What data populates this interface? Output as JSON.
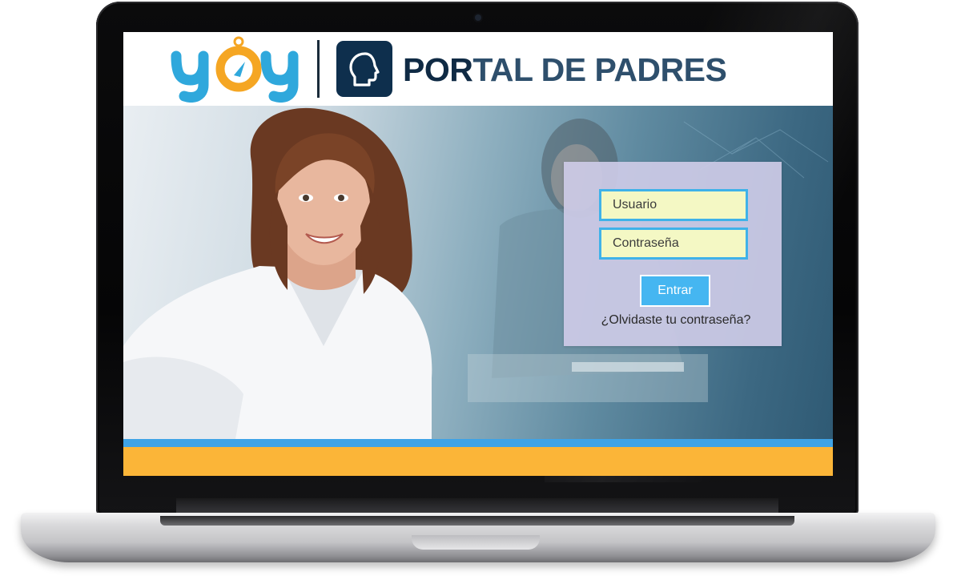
{
  "header": {
    "brand_logo_text": "yoy",
    "title_part1": "POR",
    "title_part2": "TAL DE PADRES",
    "badge_icon": "head-profile-icon"
  },
  "login": {
    "username_placeholder": "Usuario",
    "password_placeholder": "Contraseña",
    "submit_label": "Entrar",
    "forgot_label": "¿Olvidaste tu contraseña?"
  },
  "colors": {
    "title_dark": "#0f2a44",
    "title_light": "#2e4f6c",
    "badge": "#0e2f4d",
    "field_border": "#3fb2e9",
    "field_bg": "#f4f8c4",
    "button": "#45b6f1",
    "stripe_blue": "#3fa3e6",
    "stripe_orange": "#fbb538",
    "logo_blue": "#2fa8dc",
    "logo_orange": "#f5a623"
  }
}
